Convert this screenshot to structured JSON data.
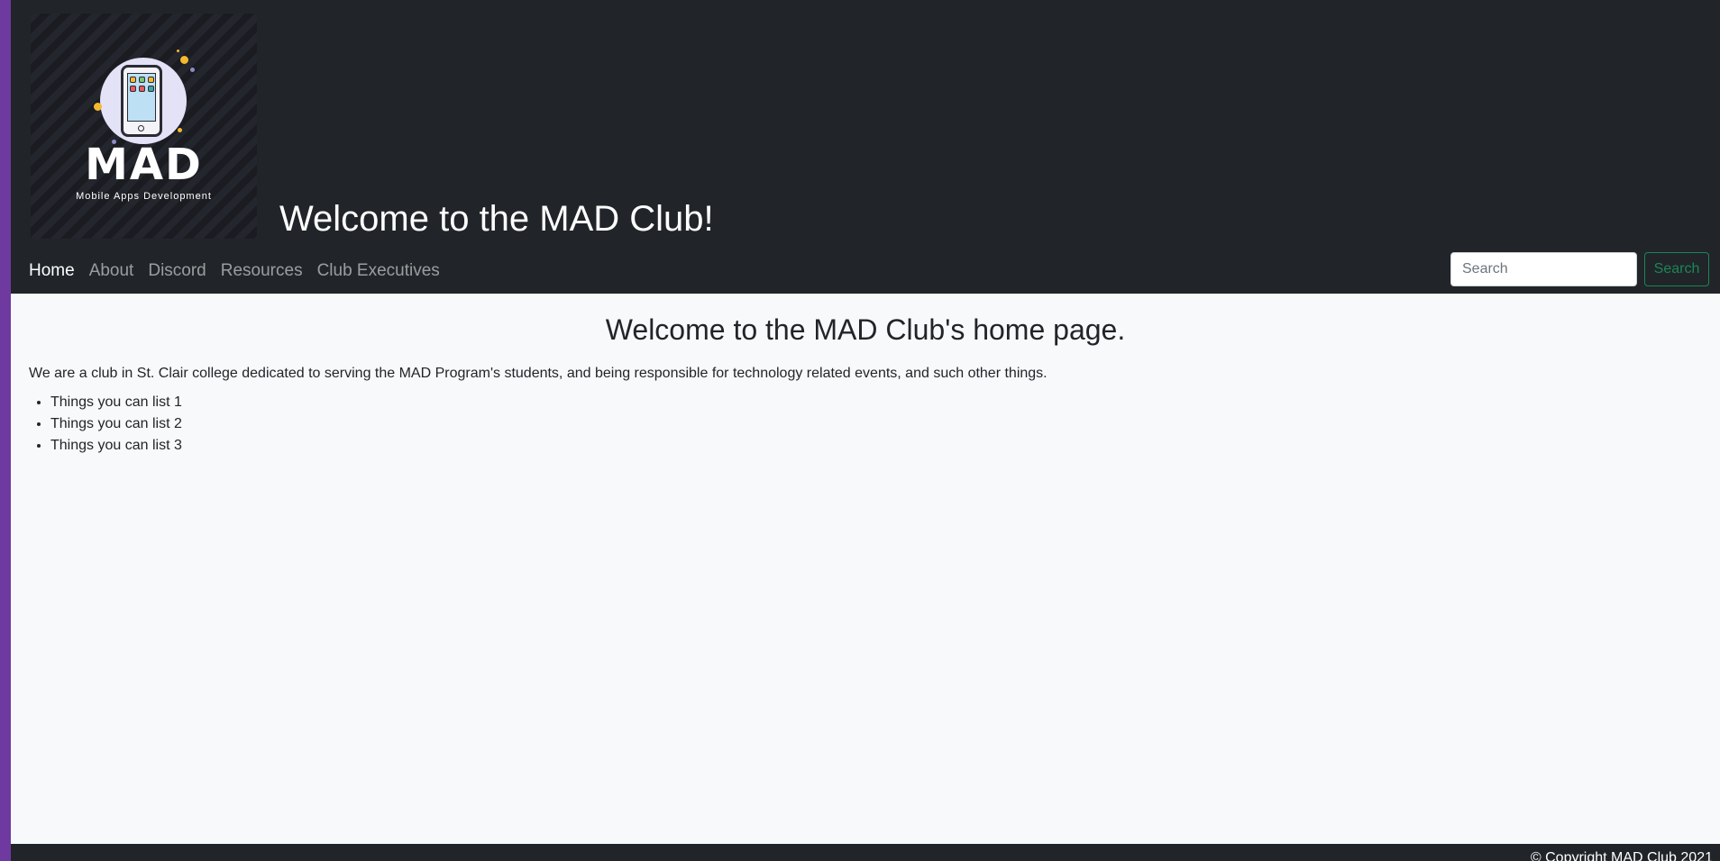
{
  "header": {
    "logo": {
      "title": "MAD",
      "subtitle": "Mobile Apps Development"
    },
    "site_title": "Welcome to the MAD Club!"
  },
  "nav": {
    "items": [
      {
        "label": "Home",
        "active": true
      },
      {
        "label": "About",
        "active": false
      },
      {
        "label": "Discord",
        "active": false
      },
      {
        "label": "Resources",
        "active": false
      },
      {
        "label": "Club Executives",
        "active": false
      }
    ]
  },
  "search": {
    "placeholder": "Search",
    "value": "",
    "button_label": "Search"
  },
  "main": {
    "heading": "Welcome to the MAD Club's home page.",
    "intro": "We are a club in St. Clair college dedicated to serving the MAD Program's students, and being responsible for technology related events, and such other things.",
    "list": [
      "Things you can list 1",
      "Things you can list 2",
      "Things you can list 3"
    ]
  },
  "footer": {
    "copyright": "© Copyright MAD Club 2021"
  },
  "colors": {
    "accent_bar": "#6f3aa0",
    "header_bg": "#212529",
    "search_button": "#198754",
    "page_bg": "#f8f9fa"
  }
}
